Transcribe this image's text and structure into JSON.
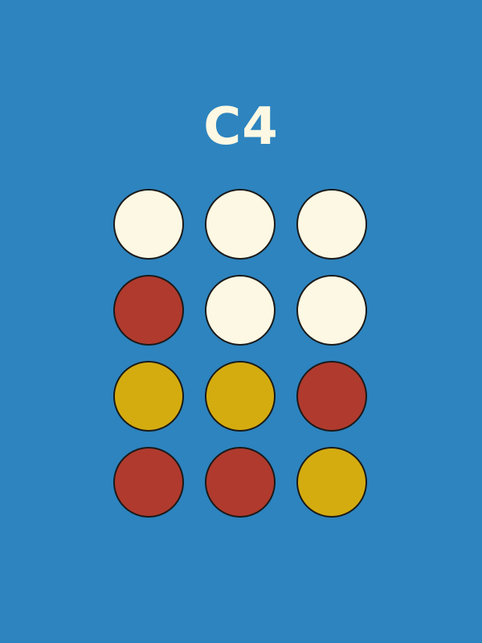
{
  "title": "C4",
  "colors": {
    "background": "#2d84bf",
    "empty": "#fdf8e3",
    "red": "#b03a2e",
    "yellow": "#d4ac10",
    "outline": "#1a1a1a"
  },
  "board": {
    "rows": 4,
    "cols": 3,
    "cells": [
      [
        "empty",
        "empty",
        "empty"
      ],
      [
        "red",
        "empty",
        "empty"
      ],
      [
        "yellow",
        "yellow",
        "red"
      ],
      [
        "red",
        "red",
        "yellow"
      ]
    ]
  }
}
